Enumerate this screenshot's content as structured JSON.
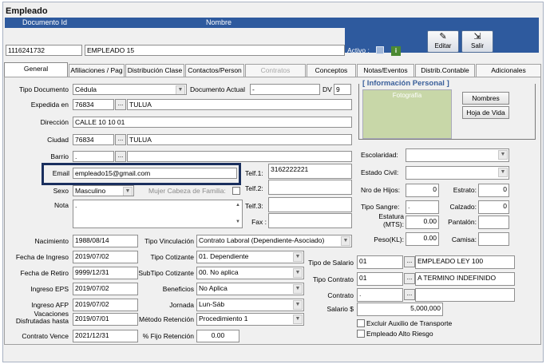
{
  "window": {
    "title": "Empleado"
  },
  "header": {
    "documento_label": "Documento Id",
    "nombre_label": "Nombre",
    "documento_value": "1116241732",
    "nombre_value": "EMPLEADO 15",
    "activo_label": "Activo :",
    "editar_label": "Editar",
    "salir_label": "Salir"
  },
  "tabs": [
    "General",
    "Afiliaciones / Pag",
    "Distribución Clase",
    "Contactos/Person",
    "Contratos",
    "Conceptos",
    "Notas/Eventos",
    "Distrib.Contable",
    "Adicionales"
  ],
  "form": {
    "tipo_documento_label": "Tipo Documento",
    "tipo_documento_value": "Cédula",
    "documento_actual_label": "Documento Actual",
    "documento_actual_value": "-",
    "dv_label": "DV",
    "dv_value": "9",
    "expedida_label": "Expedida en",
    "expedida_code": "76834",
    "expedida_city": "TULUA",
    "direccion_label": "Dirección",
    "direccion_value": "CALLE 10 10 01",
    "ciudad_label": "Ciudad",
    "ciudad_code": "76834",
    "ciudad_name": "TULUA",
    "barrio_label": "Barrio",
    "barrio_code": ".",
    "email_label": "Email",
    "email_value": "empleado15@gmail.com",
    "sexo_label": "Sexo",
    "sexo_value": "Masculino",
    "mujer_label": "Mujer Cabeza de Familia:",
    "nota_label": "Nota",
    "nota_value": ".",
    "telf1_label": "Telf.1:",
    "telf1_value": "3162222221",
    "telf2_label": "Telf.2:",
    "telf3_label": "Telf.3:",
    "fax_label": "Fax :",
    "nacimiento_label": "Nacimiento",
    "nacimiento_value": "1988/08/14",
    "tipo_vinculacion_label": "Tipo Vinculación",
    "tipo_vinculacion_value": "Contrato Laboral (Dependiente-Asociado)",
    "fecha_ingreso_label": "Fecha de Ingreso",
    "fecha_ingreso_value": "2019/07/02",
    "tipo_cotizante_label": "Tipo Cotizante",
    "tipo_cotizante_value": "01. Dependiente",
    "fecha_retiro_label": "Fecha de Retiro",
    "fecha_retiro_value": "9999/12/31",
    "subtipo_label": "SubTipo Cotizante",
    "subtipo_value": "00. No aplica",
    "ingreso_eps_label": "Ingreso EPS",
    "ingreso_eps_value": "2019/07/02",
    "beneficios_label": "Beneficios",
    "beneficios_value": "No Aplica",
    "ingreso_afp_label": "Ingreso AFP",
    "ingreso_afp_value": "2019/07/02",
    "jornada_label": "Jornada",
    "jornada_value": "Lun-Sáb",
    "vacaciones_label1": "Vacaciones",
    "vacaciones_label2": "Disfrutadas hasta",
    "vacaciones_value": "2019/07/01",
    "metodo_label": "Método Retención",
    "metodo_value": "Procedimiento 1",
    "contrato_vence_label": "Contrato Vence",
    "contrato_vence_value": "2021/12/31",
    "fijo_label": "% Fijo Retención",
    "fijo_value": "0.00",
    "tipo_salario_label": "Tipo de Salario",
    "tipo_salario_code": "01",
    "tipo_salario_name": "EMPLEADO LEY 100",
    "tipo_contrato_label": "Tipo Contrato",
    "tipo_contrato_code": "01",
    "tipo_contrato_name": "A TERMINO INDEFINIDO",
    "contrato_label": "Contrato",
    "contrato_code": ".",
    "salario_label": "Salario $",
    "salario_value": "5,000,000",
    "auxilio_label": "Excluir Auxilio de Transporte",
    "alto_riesgo_label": "Empleado Alto Riesgo"
  },
  "personal": {
    "title": "[ Información Personal ]",
    "foto_label": "Fotografía",
    "nombres_btn": "Nombres",
    "hoja_btn": "Hoja de Vida",
    "escolaridad_label": "Escolaridad:",
    "estado_civil_label": "Estado Civil:",
    "hijos_label": "Nro de Hijos:",
    "hijos_value": "0",
    "estrato_label": "Estrato:",
    "estrato_value": "0",
    "sangre_label": "Tipo Sangre:",
    "sangre_value": ".",
    "calzado_label": "Calzado:",
    "calzado_value": "0",
    "estatura_label1": "Estatura",
    "estatura_label2": "(MTS):",
    "estatura_value": "0.00",
    "pantalon_label": "Pantalón:",
    "peso_label": "Peso(KL):",
    "peso_value": "0.00",
    "camisa_label": "Camisa:"
  },
  "colors": {
    "header_blue": "#2e5a9e",
    "highlight_border": "#1a2f5e"
  },
  "icons": [
    "gear-icon",
    "edit-icon",
    "exit-icon",
    "info-icon",
    "dropdown-arrow-icon"
  ]
}
